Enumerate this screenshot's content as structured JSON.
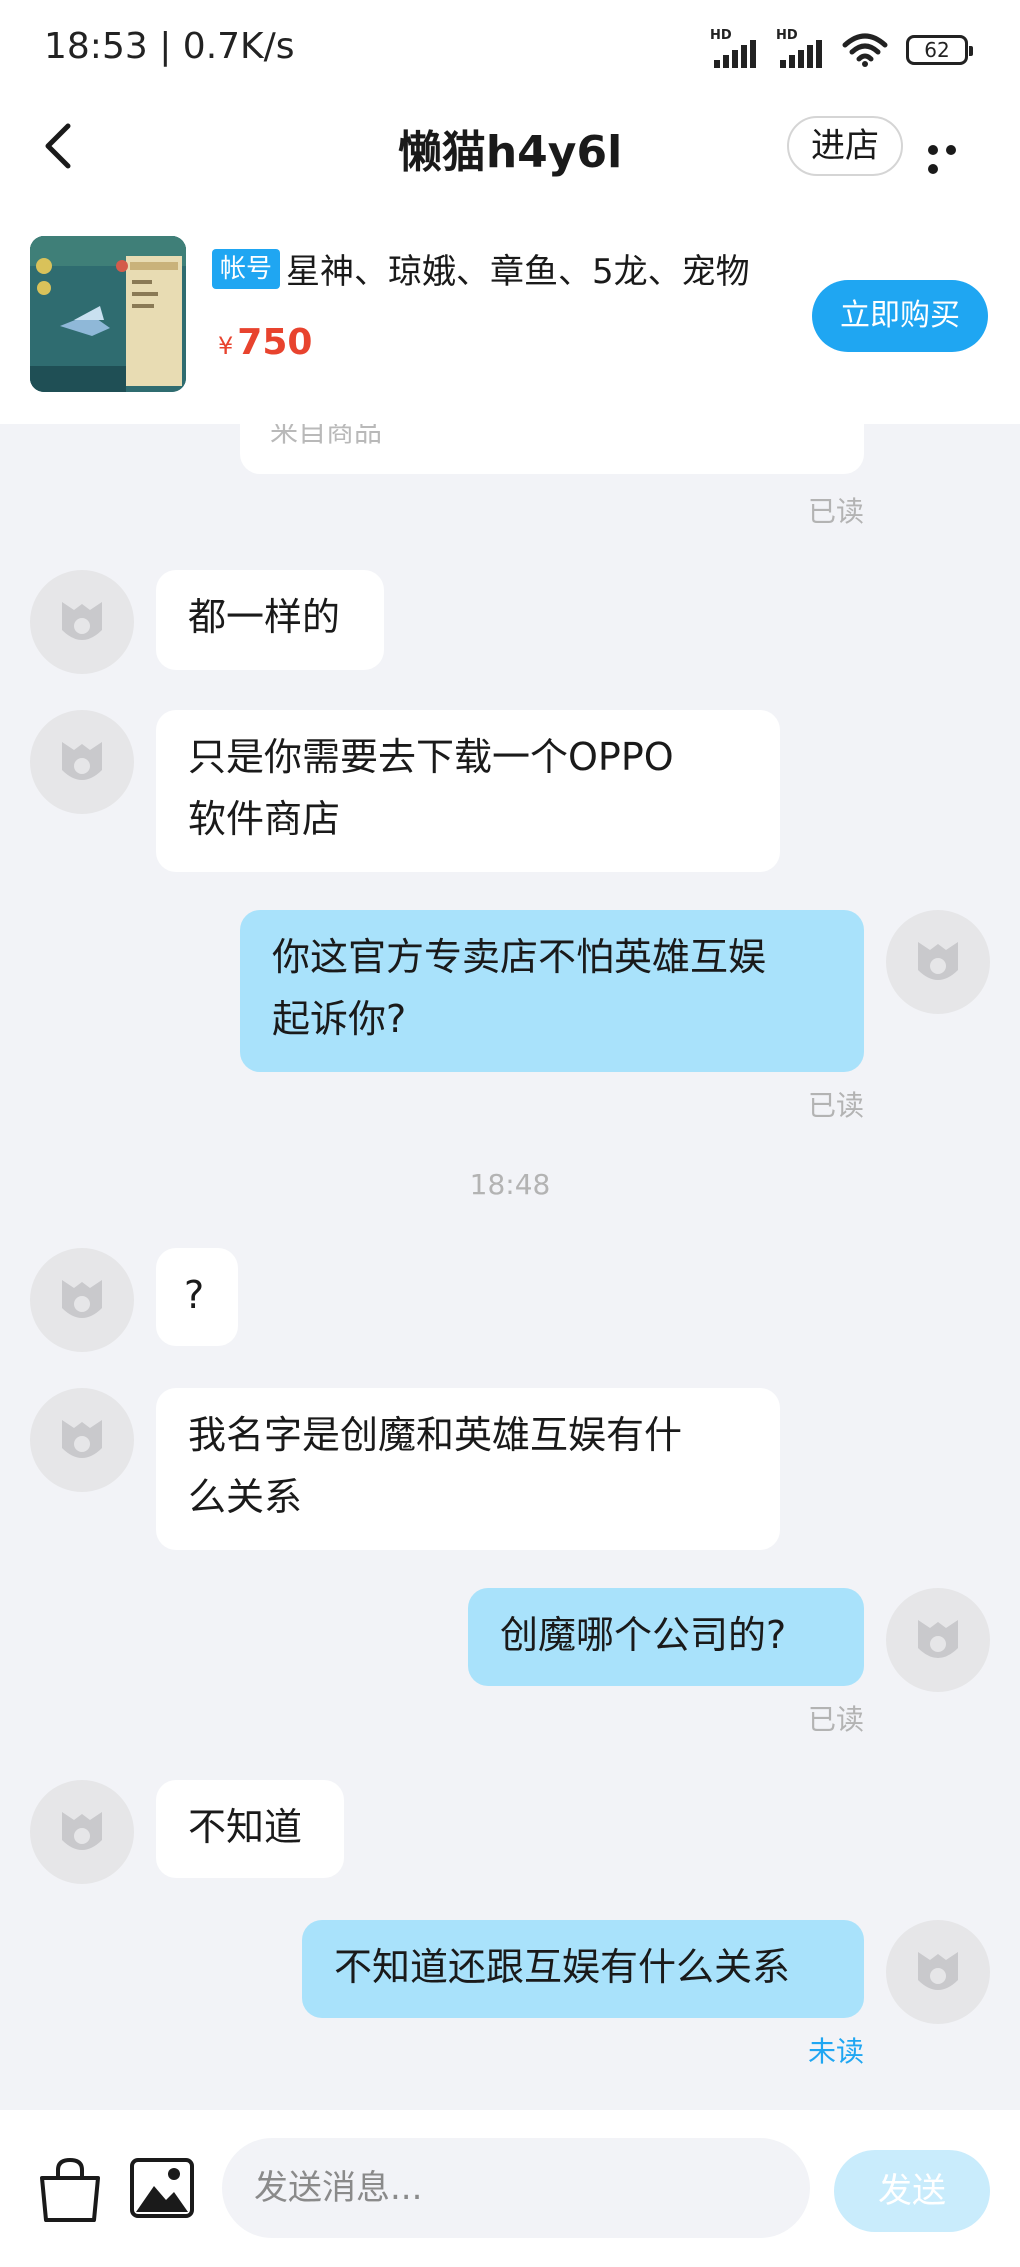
{
  "status_bar": {
    "time": "18:53",
    "separator": "|",
    "speed": "0.7K/s",
    "hd1": "HD",
    "hd2": "HD",
    "battery": "62"
  },
  "nav": {
    "title": "懒猫h4y6l",
    "shop_label": "进店"
  },
  "product": {
    "tag": "帐号",
    "title": "星神、琼娥、章鱼、5龙、宠物",
    "price_symbol": "¥",
    "price": "750",
    "buy_label": "立即购买"
  },
  "chat": {
    "partial_text": "来自商品",
    "read_label": "已读",
    "unread_label": "未读",
    "divider_time": "18:48",
    "messages": [
      {
        "side": "left",
        "text": "都一样的"
      },
      {
        "side": "left",
        "lines": [
          "只是你需要去下载一个OPPO",
          "软件商店"
        ]
      },
      {
        "side": "right",
        "lines": [
          "你这官方专卖店不怕英雄互娱",
          "起诉你?"
        ],
        "status": "已读"
      },
      {
        "side": "left",
        "text": "?"
      },
      {
        "side": "left",
        "lines": [
          "我名字是创魔和英雄互娱有什",
          "么关系"
        ]
      },
      {
        "side": "right",
        "text": "创魔哪个公司的?",
        "status": "已读"
      },
      {
        "side": "left",
        "text": "不知道"
      },
      {
        "side": "right",
        "text": "不知道还跟互娱有什么关系",
        "status": "未读"
      }
    ]
  },
  "composer": {
    "placeholder": "发送消息...",
    "send_label": "发送"
  },
  "colors": {
    "accent": "#1fa6f2",
    "price": "#e8432e",
    "bubble_self": "#a9e2fb",
    "bubble_other": "#ffffff",
    "background": "#f2f3f7"
  }
}
